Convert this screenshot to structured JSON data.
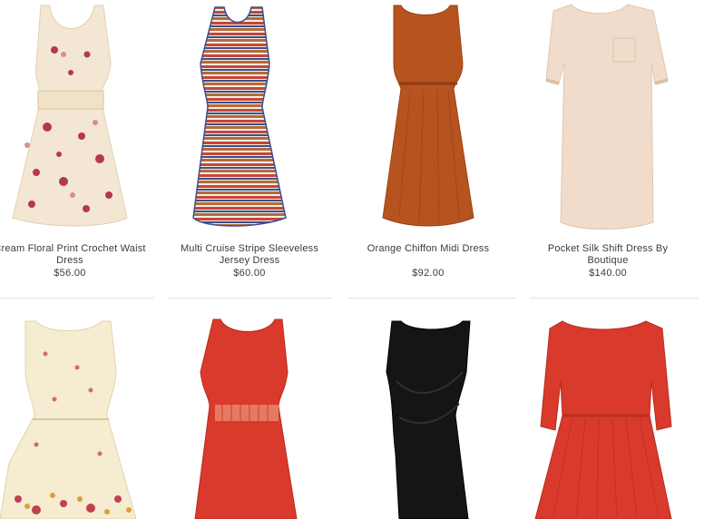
{
  "products": [
    {
      "name": "Cream Floral Print Crochet Waist Dress",
      "price": "$56.00",
      "icon": "cream-floral-dress-image"
    },
    {
      "name": "Multi Cruise Stripe Sleeveless Jersey Dress",
      "price": "$60.00",
      "icon": "striped-jersey-dress-image"
    },
    {
      "name": "Orange Chiffon Midi Dress",
      "price": "$92.00",
      "icon": "orange-chiffon-dress-image"
    },
    {
      "name": "Pocket Silk Shift Dress By Boutique",
      "price": "$140.00",
      "icon": "silk-shift-dress-image"
    },
    {
      "name": "",
      "price": "",
      "icon": "floral-border-dress-image"
    },
    {
      "name": "",
      "price": "",
      "icon": "red-crochet-waist-dress-image"
    },
    {
      "name": "",
      "price": "",
      "icon": "black-draped-dress-image"
    },
    {
      "name": "",
      "price": "",
      "icon": "red-pleated-dress-image"
    }
  ],
  "colors": {
    "cream": "#f3e7d3",
    "floral": "#b5384a",
    "stripe_red": "#c9443a",
    "stripe_blue": "#3b4f8c",
    "orange": "#b6531f",
    "shift": "#f1dccb",
    "red": "#d93a2c",
    "black": "#151515",
    "text": "#3a3a3a",
    "divider": "#e4e4e4"
  }
}
